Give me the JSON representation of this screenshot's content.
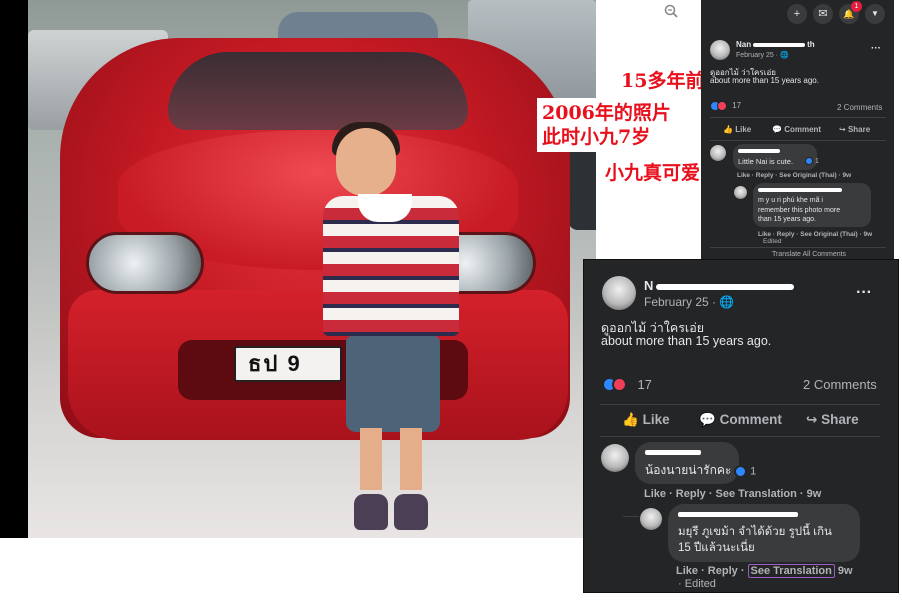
{
  "viewer": {
    "zoom_in_icon": "zoom-in-icon",
    "zoom_out_icon": "zoom-out-icon",
    "fullscreen_icon": "fullscreen-icon",
    "plate_text": "ธป 9"
  },
  "captions": [
    "15多年前",
    "2006年的照片\n此时小九7岁",
    "小九真可爱"
  ],
  "topbar": {
    "icons": [
      "plus-icon",
      "messenger-icon",
      "bell-icon",
      "caret-down-icon"
    ],
    "plus_glyph": "+",
    "messenger_glyph": "✉",
    "bell_glyph": "🔔",
    "caret_glyph": "▼",
    "notification_count": "1"
  },
  "post": {
    "author_visible_prefix": "Nan",
    "author_visible_suffix": "th",
    "date": "February 25 · 🌐",
    "more_glyph": "···",
    "text_thai": "ดูออกไม้ ว่าใครเอ่ย",
    "text_en": "about more than 15 years ago.",
    "reactions_count": "17",
    "comments_count": "2 Comments",
    "actions": {
      "like": "Like",
      "comment": "Comment",
      "share": "Share"
    },
    "action_glyphs": {
      "like": "👍",
      "comment": "💬",
      "share": "↪"
    }
  },
  "comment1": {
    "text_en": "Little Nai is cute.",
    "text_th": "น้องนายน่ารักคะ",
    "reaction_count": "1",
    "links_small": "Like · Reply · See Original (Thai) · 9w",
    "like": "Like",
    "reply": "Reply",
    "see_translation": "See Translation",
    "time": "9w"
  },
  "comment2": {
    "text_en": "m y u ri phu khe mã i remember this photo more than 15 years ago.",
    "text_en_lines": [
      "m y u ri phú khe mã i",
      "remember this photo more",
      "than 15 years ago."
    ],
    "text_th_lines": [
      "มยุรี ภูเขม้า จำได้ด้วย รูปนี้ เกิน",
      "15 ปีแล้วนะเนี่ย"
    ],
    "reaction_count": "",
    "links_small": "Like · Reply · See Original (Thai) · 9w",
    "edited": "Edited",
    "like": "Like",
    "reply": "Reply",
    "see_translation": "See Translation",
    "time": "9w"
  },
  "translate_all": "Translate All Comments",
  "large_post": {
    "author_visible_prefix": "N",
    "date": "February 25 · 🌐"
  },
  "colors": {
    "panel_bg": "#242526",
    "caption_red": "#e8101c",
    "like_blue": "#2d88ff",
    "love_red": "#f33e58"
  }
}
